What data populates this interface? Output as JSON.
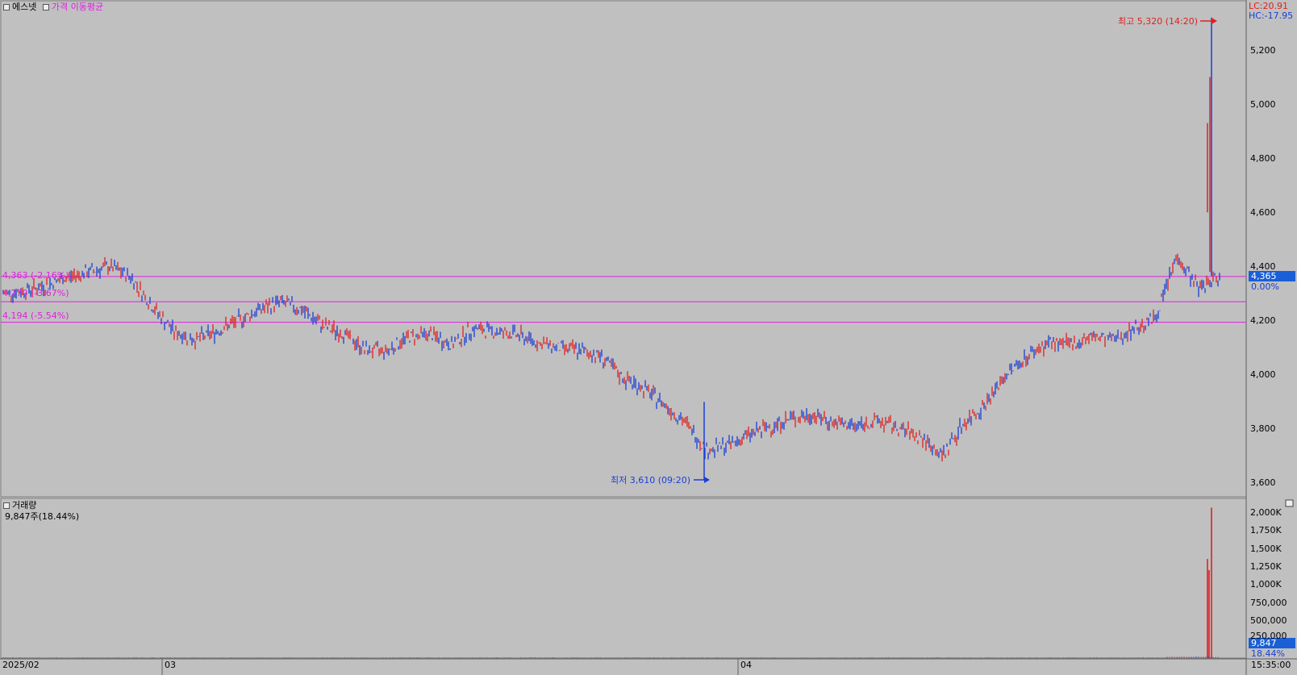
{
  "header": {
    "stock_name": "에스넷",
    "indicator_label": "가격 이동평균",
    "lc_label": "LC:20.91",
    "hc_label": "HC:-17.95"
  },
  "price_axis_ticks": [
    "5,200",
    "5,000",
    "4,800",
    "4,600",
    "4,400",
    "4,200",
    "4,000",
    "3,800",
    "3,600"
  ],
  "current_price": {
    "value": "4,365",
    "change": "0.00%"
  },
  "ref_lines": [
    {
      "label": "4,363 (-2.16%)",
      "value": 4363
    },
    {
      "label": "4,270 (-3.67%)",
      "value": 4270
    },
    {
      "label": "4,194 (-5.54%)",
      "value": 4194
    }
  ],
  "annotations": {
    "high": "최고 5,320 (14:20)",
    "low": "최저 3,610 (09:20)"
  },
  "volume_panel": {
    "title": "거래량",
    "info": "9,847주(18.44%)",
    "ticks": [
      "2,000K",
      "1,750K",
      "1,500K",
      "1,250K",
      "1,000K",
      "750,000",
      "500,000",
      "250,000"
    ],
    "current_value": "9,847",
    "current_pct": "18.44%"
  },
  "x_labels": [
    "2025/02",
    "03",
    "04"
  ],
  "time_label": "15:35:00",
  "colors": {
    "up": "#e02020",
    "down": "#1a3fd6",
    "ref_line": "#e020e0",
    "bg": "#c0c0c0"
  },
  "chart_data": {
    "type": "line",
    "title": "에스넷",
    "xlabel": "",
    "ylabel": "",
    "ylim": [
      3550,
      5360
    ],
    "x": [
      "2025/02",
      "",
      "",
      "",
      "",
      "",
      "03",
      "",
      "",
      "",
      "",
      "",
      "",
      "",
      "",
      "",
      "",
      "",
      "",
      "",
      "",
      "",
      "",
      "",
      "",
      "",
      "",
      "04",
      "",
      "",
      "",
      "",
      "",
      "",
      "",
      "",
      "",
      "",
      "",
      "",
      "",
      "",
      "",
      "",
      "",
      "",
      "",
      "",
      "",
      ""
    ],
    "series": [
      {
        "name": "price",
        "values": [
          4300,
          4310,
          4330,
          4360,
          4380,
          4400,
          4360,
          4250,
          4160,
          4130,
          4160,
          4200,
          4240,
          4270,
          4240,
          4180,
          4150,
          4090,
          4090,
          4140,
          4150,
          4110,
          4170,
          4160,
          4150,
          4120,
          4100,
          4090,
          4070,
          3990,
          3950,
          3890,
          3820,
          3720,
          3740,
          3780,
          3810,
          3840,
          3850,
          3820,
          3810,
          3830,
          3800,
          3770,
          3700,
          3820,
          3890,
          4000,
          4070,
          4120,
          4110,
          4140,
          4130,
          4170,
          4210,
          4440,
          4320,
          4365
        ]
      },
      {
        "name": "volume",
        "values": [
          5,
          5,
          5,
          5,
          5,
          5,
          5,
          5,
          5,
          5,
          5,
          5,
          5,
          5,
          5,
          5,
          5,
          5,
          5,
          5,
          5,
          5,
          5,
          5,
          5,
          5,
          5,
          5,
          5,
          5,
          5,
          5,
          5,
          5,
          5,
          5,
          5,
          5,
          5,
          5,
          5,
          5,
          5,
          5,
          5,
          5,
          5,
          5,
          5,
          5,
          5,
          5,
          5,
          5,
          5,
          1350,
          2050,
          9.8
        ]
      }
    ],
    "high": 5320,
    "low": 3610
  }
}
